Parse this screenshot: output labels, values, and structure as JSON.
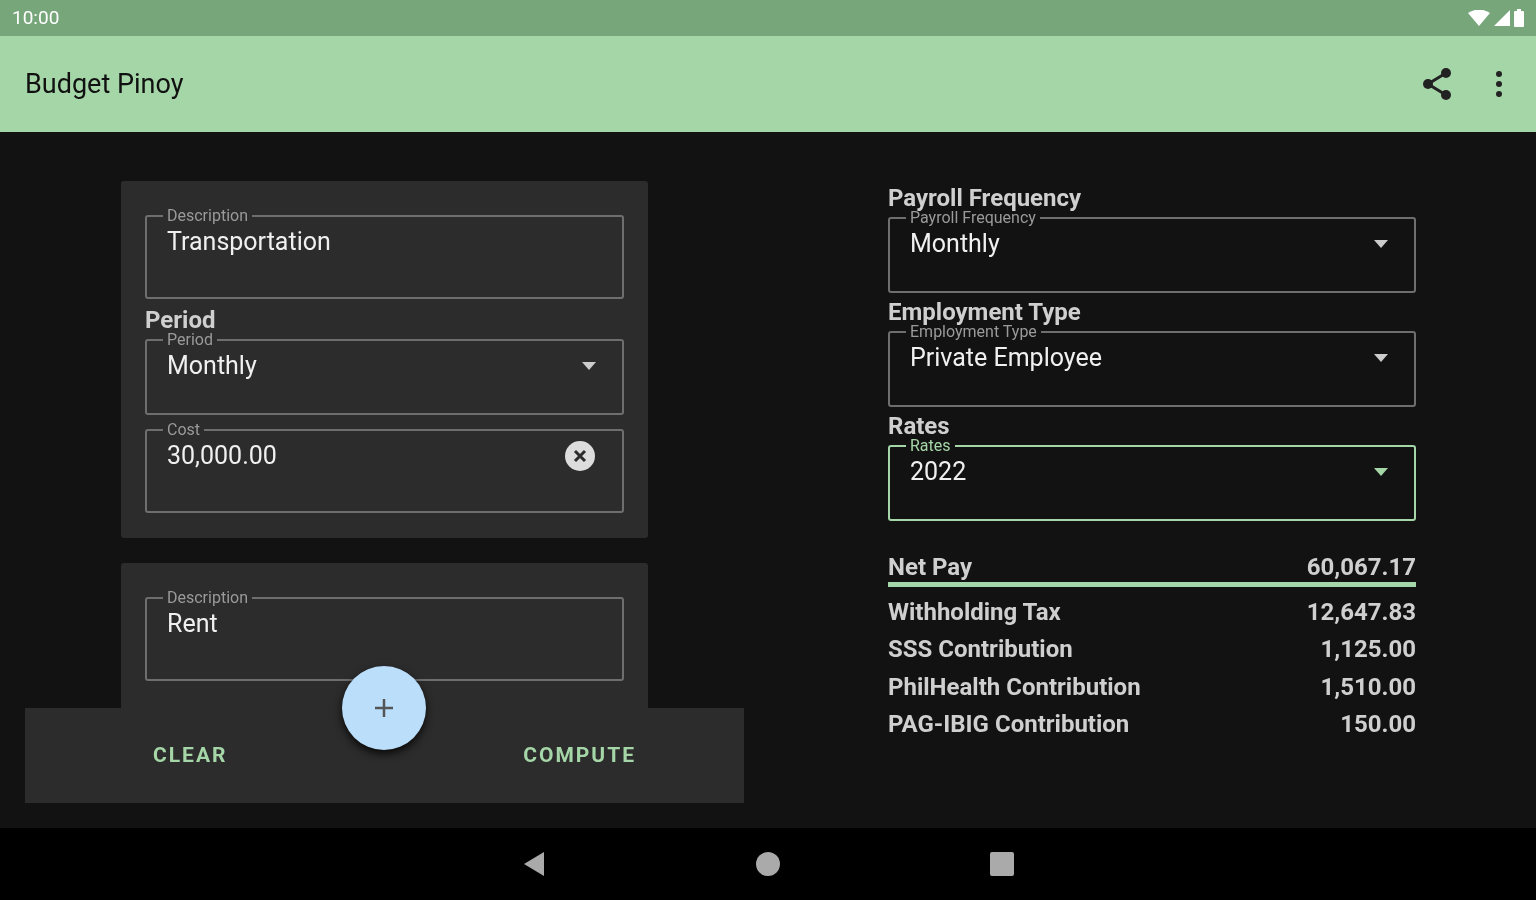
{
  "status_bar": {
    "time": "10:00"
  },
  "app_bar": {
    "title": "Budget Pinoy"
  },
  "expenses": [
    {
      "fields": [
        {
          "kind": "text",
          "label": "Description",
          "value": "Transportation"
        },
        {
          "kind": "dropdown",
          "heading": "Period",
          "label": "Period",
          "value": "Monthly"
        },
        {
          "kind": "clearable",
          "label": "Cost",
          "value": "30,000.00"
        }
      ]
    },
    {
      "fields": [
        {
          "kind": "text",
          "label": "Description",
          "value": "Rent"
        }
      ]
    }
  ],
  "settings": [
    {
      "heading": "Payroll Frequency",
      "label": "Payroll Frequency",
      "value": "Monthly",
      "focused": false
    },
    {
      "heading": "Employment Type",
      "label": "Employment Type",
      "value": "Private Employee",
      "focused": false
    },
    {
      "heading": "Rates",
      "label": "Rates",
      "value": "2022",
      "focused": true
    }
  ],
  "summary": [
    {
      "kind": "total",
      "label": "Net Pay",
      "value": "60,067.17"
    },
    {
      "kind": "item",
      "label": "Withholding Tax",
      "value": "12,647.83"
    },
    {
      "kind": "item",
      "label": "SSS Contribution",
      "value": "1,125.00"
    },
    {
      "kind": "item",
      "label": "PhilHealth Contribution",
      "value": "1,510.00"
    },
    {
      "kind": "item",
      "label": "PAG-IBIG Contribution",
      "value": "150.00"
    }
  ],
  "bottom_bar": {
    "buttons": [
      "CLEAR",
      "COMPUTE"
    ]
  }
}
